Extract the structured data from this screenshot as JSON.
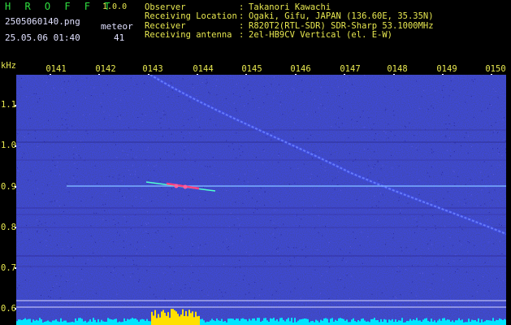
{
  "header": {
    "app_name": "H R O F F T",
    "app_version": "1.0.0",
    "file_name": "2505060140.png",
    "meteor_label": "meteor",
    "datetime": "25.05.06 01:40",
    "meteor_count": "41"
  },
  "station": [
    {
      "label": "Observer",
      "sep": ":",
      "value": "Takanori Kawachi"
    },
    {
      "label": "Receiving Location",
      "sep": ":",
      "value": "Ogaki, Gifu, JAPAN (136.60E, 35.35N)"
    },
    {
      "label": "Receiver",
      "sep": ":",
      "value": "R820T2(RTL-SDR) SDR-Sharp 53.1000MHz"
    },
    {
      "label": "Receiving antenna",
      "sep": ":",
      "value": "2el-HB9CV Vertical (el. E-W)"
    }
  ],
  "axis": {
    "unit": "kHz",
    "freq_labels": [
      "1.1",
      "1.0",
      "0.9",
      "0.8",
      "0.7",
      "0.6"
    ],
    "time_labels": [
      "0141",
      "0142",
      "0143",
      "0144",
      "0145",
      "0146",
      "0147",
      "0148",
      "0149",
      "0150"
    ]
  },
  "colors": {
    "background": "#000000",
    "waterfall_noise": "#10107a",
    "label_text": "#e8e850",
    "app_name": "#30e040",
    "carrier": "#7ab0ff",
    "meteor_trail": "#8aa0ff",
    "bottom_bar": "#00e5ff",
    "bottom_bar_peak": "#ffe000"
  }
}
